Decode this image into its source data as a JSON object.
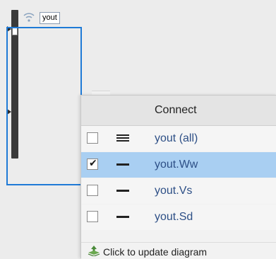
{
  "diagram": {
    "signal_label": "yout",
    "icons": {
      "signal": "wifi-signal-icon",
      "update": "diagram-update-icon",
      "single_line": "single-line-icon",
      "multi_line": "multi-line-icon"
    }
  },
  "connect_menu": {
    "title": "Connect",
    "items": [
      {
        "label": "yout (all)",
        "checked": false,
        "icon": "multi-line-icon"
      },
      {
        "label": "yout.Ww",
        "checked": true,
        "icon": "single-line-icon"
      },
      {
        "label": "yout.Vs",
        "checked": false,
        "icon": "single-line-icon"
      },
      {
        "label": "yout.Sd",
        "checked": false,
        "icon": "single-line-icon"
      }
    ],
    "footer_label": "Click to update diagram",
    "colors": {
      "selected_row": "#a9cff2",
      "item_text": "#2d4f86",
      "block_border": "#1f7ad6"
    }
  }
}
